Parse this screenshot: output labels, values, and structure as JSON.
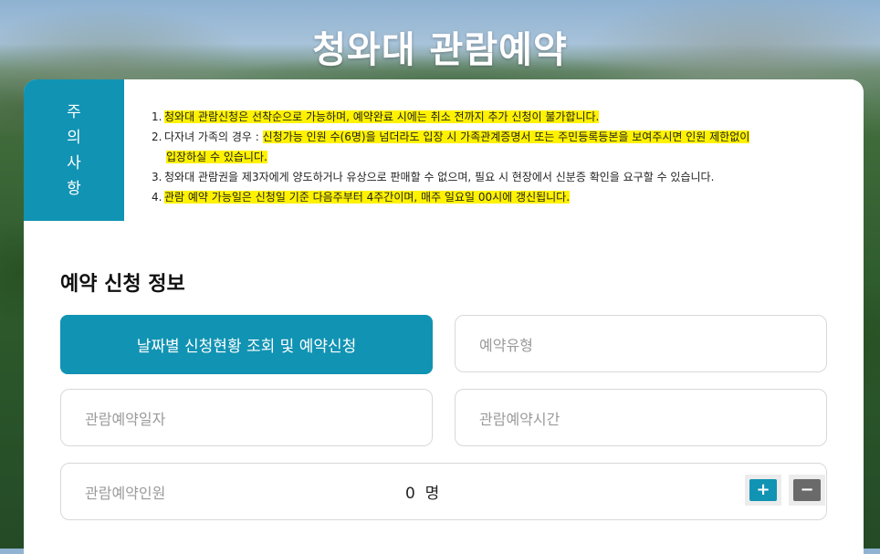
{
  "page": {
    "title": "청와대 관람예약"
  },
  "notice": {
    "tab_chars": [
      "주",
      "의",
      "사",
      "항"
    ],
    "items": [
      {
        "num": "1.",
        "text": "청와대 관람신청은 선착순으로 가능하며, 예약완료 시에는 취소 전까지 추가 신청이 불가합니다."
      },
      {
        "num": "2.",
        "text_a": "다자녀 가족의 경우 : ",
        "text_b": "신청가능 인원 수(6명)을 넘더라도 입장 시 가족관계증명서 또는 주민등록등본을 보여주시면 인원 제한없이",
        "text_c": "입장하실 수 있습니다."
      },
      {
        "num": "3.",
        "text": "청와대 관람권을 제3자에게 양도하거나 유상으로 판매할 수 없으며, 필요 시 현장에서 신분증 확인을 요구할 수 있습니다."
      },
      {
        "num": "4.",
        "text": "관람 예약 가능일은 신청일 기준 다음주부터 4주간이며, 매주 일요일 00시에 갱신됩니다."
      }
    ]
  },
  "form": {
    "section_title": "예약 신청 정보",
    "status_button": "날짜별 신청현황 조회 및 예약신청",
    "type_placeholder": "예약유형",
    "date_placeholder": "관람예약일자",
    "time_placeholder": "관람예약시간",
    "people_label": "관람예약인원",
    "people_count": "0",
    "people_unit": "명",
    "plus_label": "+",
    "minus_label": "−"
  },
  "colors": {
    "accent": "#1193b3",
    "highlight": "#fff200",
    "minus": "#6a6a6a"
  }
}
